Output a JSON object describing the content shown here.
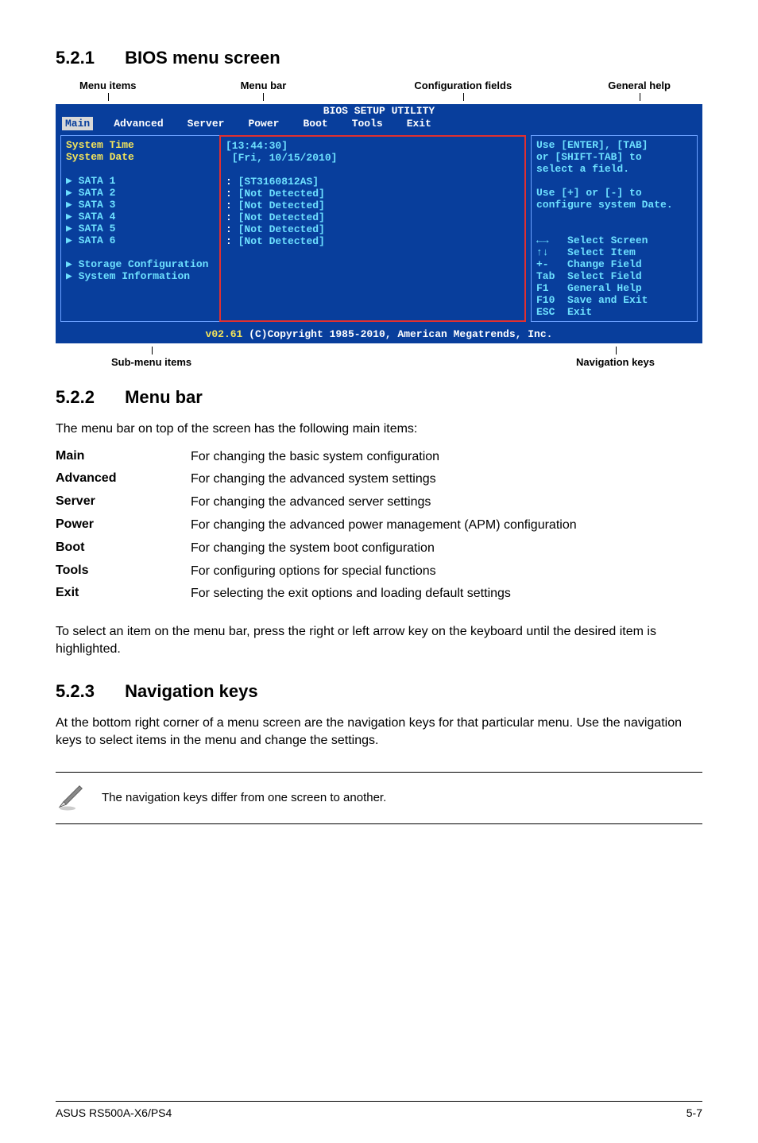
{
  "section1": {
    "number": "5.2.1",
    "title": "BIOS menu screen"
  },
  "top_labels": [
    "Menu items",
    "Menu bar",
    "Configuration fields",
    "General help"
  ],
  "bottom_labels": [
    "Sub-menu items",
    "Navigation keys"
  ],
  "bios": {
    "title": "BIOS SETUP UTILITY",
    "tabs": [
      "Main",
      "Advanced",
      "Server",
      "Power",
      "Boot",
      "Tools",
      "Exit"
    ],
    "left": {
      "system_time": "System Time",
      "system_date": "System Date",
      "sata": [
        "SATA 1",
        "SATA 2",
        "SATA 3",
        "SATA 4",
        "SATA 5",
        "SATA 6"
      ],
      "storage": "Storage Configuration",
      "sysinfo": "System Information"
    },
    "center": {
      "time": "[13:44:30]",
      "date": "[Fri, 10/15/2010]",
      "vals": [
        "[ST3160812AS]",
        "[Not Detected]",
        "[Not Detected]",
        "[Not Detected]",
        "[Not Detected]",
        "[Not Detected]"
      ]
    },
    "right": {
      "help1": "Use [ENTER], [TAB]",
      "help2": "or [SHIFT-TAB] to",
      "help3": "select a field.",
      "help4": "Use [+] or [-] to",
      "help5": "configure system Date.",
      "nav": [
        {
          "k": "←→",
          "v": "Select Screen"
        },
        {
          "k": "↑↓",
          "v": "Select Item"
        },
        {
          "k": "+-",
          "v": "Change Field"
        },
        {
          "k": "Tab",
          "v": "Select Field"
        },
        {
          "k": "F1",
          "v": "General Help"
        },
        {
          "k": "F10",
          "v": "Save and Exit"
        },
        {
          "k": "ESC",
          "v": "Exit"
        }
      ]
    },
    "footer_version": "v02.61",
    "footer_text": " (C)Copyright 1985-2010, American Megatrends, Inc."
  },
  "section2": {
    "number": "5.2.2",
    "title": "Menu bar"
  },
  "section2_intro": "The menu bar on top of the screen has the following main items:",
  "menu_defs": [
    {
      "term": "Main",
      "desc": "For changing the basic system configuration"
    },
    {
      "term": "Advanced",
      "desc": "For changing the advanced system settings"
    },
    {
      "term": "Server",
      "desc": "For changing the advanced server settings"
    },
    {
      "term": "Power",
      "desc": "For changing the advanced power management (APM) configuration"
    },
    {
      "term": "Boot",
      "desc": "For changing the system boot configuration"
    },
    {
      "term": "Tools",
      "desc": "For configuring options for special functions"
    },
    {
      "term": "Exit",
      "desc": "For selecting the exit options and loading default settings"
    }
  ],
  "section2_outro": "To select an item on the menu bar, press the right or left arrow key on the keyboard until the desired item is highlighted.",
  "section3": {
    "number": "5.2.3",
    "title": "Navigation keys"
  },
  "section3_body": "At the bottom right corner of a menu screen are the navigation keys for that particular menu. Use the navigation keys to select items in the menu and change the settings.",
  "note_text": "The navigation keys differ from one screen to another.",
  "footer_left": "ASUS RS500A-X6/PS4",
  "footer_right": "5-7"
}
